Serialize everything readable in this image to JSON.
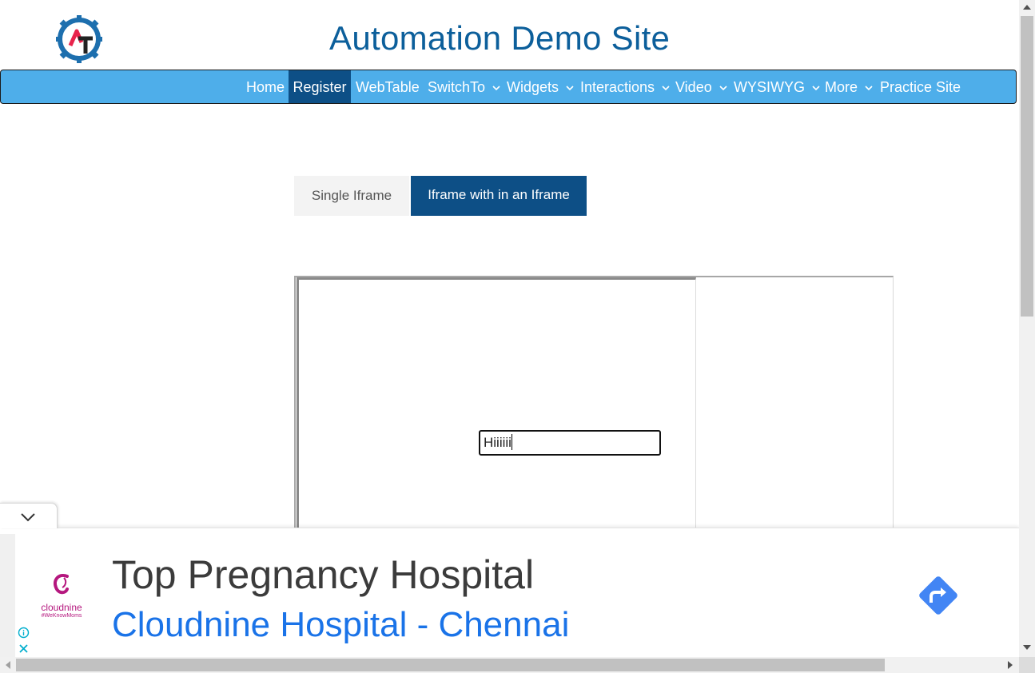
{
  "header": {
    "title": "Automation Demo Site",
    "logo_letters": "AT",
    "logo_icon": "gear-logo-icon"
  },
  "nav": {
    "items": [
      {
        "label": "Home"
      },
      {
        "label": "Register",
        "active": true
      },
      {
        "label": "WebTable"
      },
      {
        "label": "SwitchTo",
        "dropdown": true
      },
      {
        "label": "Widgets",
        "dropdown": true
      },
      {
        "label": "Interactions",
        "dropdown": true
      },
      {
        "label": "Video",
        "dropdown": true
      },
      {
        "label": "WYSIWYG",
        "dropdown": true
      },
      {
        "label": "More",
        "dropdown": true
      },
      {
        "label": "Practice Site"
      }
    ]
  },
  "tabs": {
    "single": "Single Iframe",
    "nested": "Iframe with in an Iframe",
    "active": "nested"
  },
  "frame": {
    "input_value": "Hiiiiii"
  },
  "ad": {
    "brand": "cloudnine",
    "tagline": "#WeKnowMoms",
    "headline": "Top Pregnancy Hospital",
    "subline": "Cloudnine Hospital - Chennai"
  },
  "colors": {
    "nav_bg": "#4eaeea",
    "nav_active": "#0d4f86",
    "title": "#0c5f9b",
    "ad_link": "#1a73e8",
    "ad_button": "#4285f4"
  }
}
